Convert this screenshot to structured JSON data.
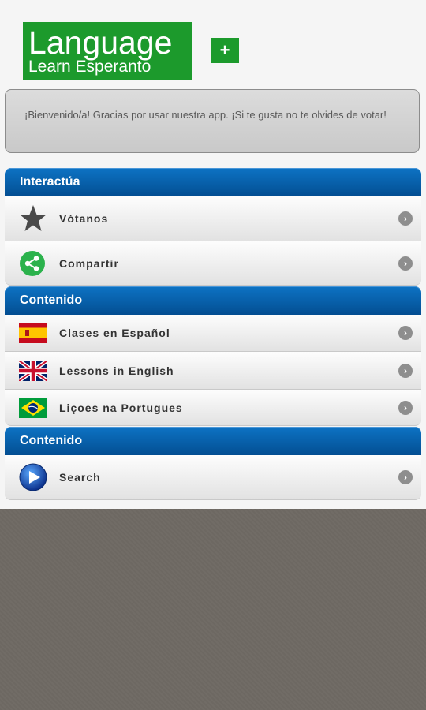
{
  "app": {
    "logo_line1": "Language",
    "logo_line2": "Learn Esperanto",
    "plus_label": "+"
  },
  "welcome_text": "¡Bienvenido/a! Gracias por usar nuestra app. ¡Si te gusta no te olvides de votar!",
  "groups": [
    {
      "title": "Interactúa",
      "items": [
        {
          "label": "Vótanos",
          "icon": "star-icon"
        },
        {
          "label": "Compartir",
          "icon": "share-icon"
        }
      ]
    },
    {
      "title": "Contenido",
      "items": [
        {
          "label": "Clases en Español",
          "icon": "spain-flag-icon"
        },
        {
          "label": "Lessons in English",
          "icon": "uk-flag-icon"
        },
        {
          "label": "Liçoes na Portugues",
          "icon": "brazil-flag-icon"
        }
      ]
    },
    {
      "title": "Contenido",
      "items": [
        {
          "label": "Search",
          "icon": "play-icon"
        }
      ]
    }
  ],
  "colors": {
    "brand_green": "#1c9a2c",
    "header_blue": "#034e92",
    "background_texture": "#6d6862"
  }
}
